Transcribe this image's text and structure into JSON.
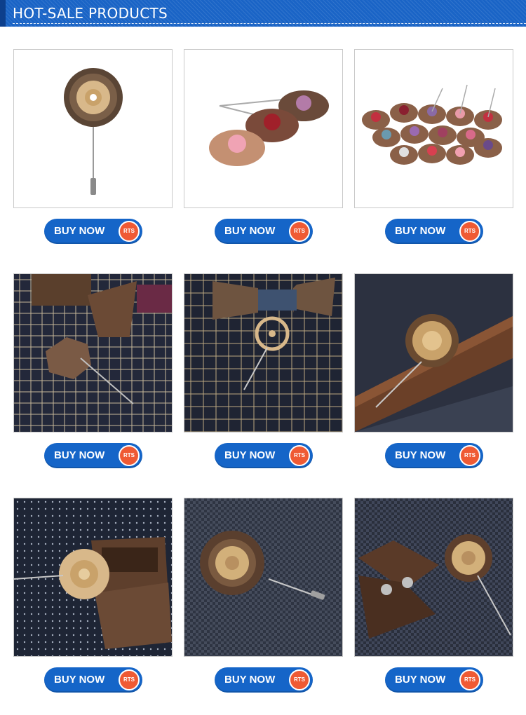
{
  "header": {
    "title": "HOT-SALE PRODUCTS"
  },
  "products": [
    {
      "button_label": "BUY NOW",
      "badge": "RTS",
      "image": "wooden-flower-lapel-pin-white-background"
    },
    {
      "button_label": "BUY NOW",
      "badge": "RTS",
      "image": "layered-wooden-rose-lapel-pins"
    },
    {
      "button_label": "BUY NOW",
      "badge": "RTS",
      "image": "wooden-flower-lapel-pin-collection"
    },
    {
      "button_label": "BUY NOW",
      "badge": "RTS",
      "image": "wooden-lapel-pin-with-bow-tie-on-plaid"
    },
    {
      "button_label": "BUY NOW",
      "badge": "RTS",
      "image": "wooden-blossom-pin-with-bow-tie"
    },
    {
      "button_label": "BUY NOW",
      "badge": "RTS",
      "image": "wooden-flower-pin-on-wood-block"
    },
    {
      "button_label": "BUY NOW",
      "badge": "RTS",
      "image": "wooden-flower-pin-with-cufflink-box"
    },
    {
      "button_label": "BUY NOW",
      "badge": "RTS",
      "image": "wooden-sunflower-lapel-pin-on-fabric"
    },
    {
      "button_label": "BUY NOW",
      "badge": "RTS",
      "image": "wooden-lapel-pin-with-cufflink-box-set"
    }
  ],
  "colors": {
    "header": "#1a64c6",
    "button": "#1565c8",
    "badge": "#ef5a34"
  }
}
